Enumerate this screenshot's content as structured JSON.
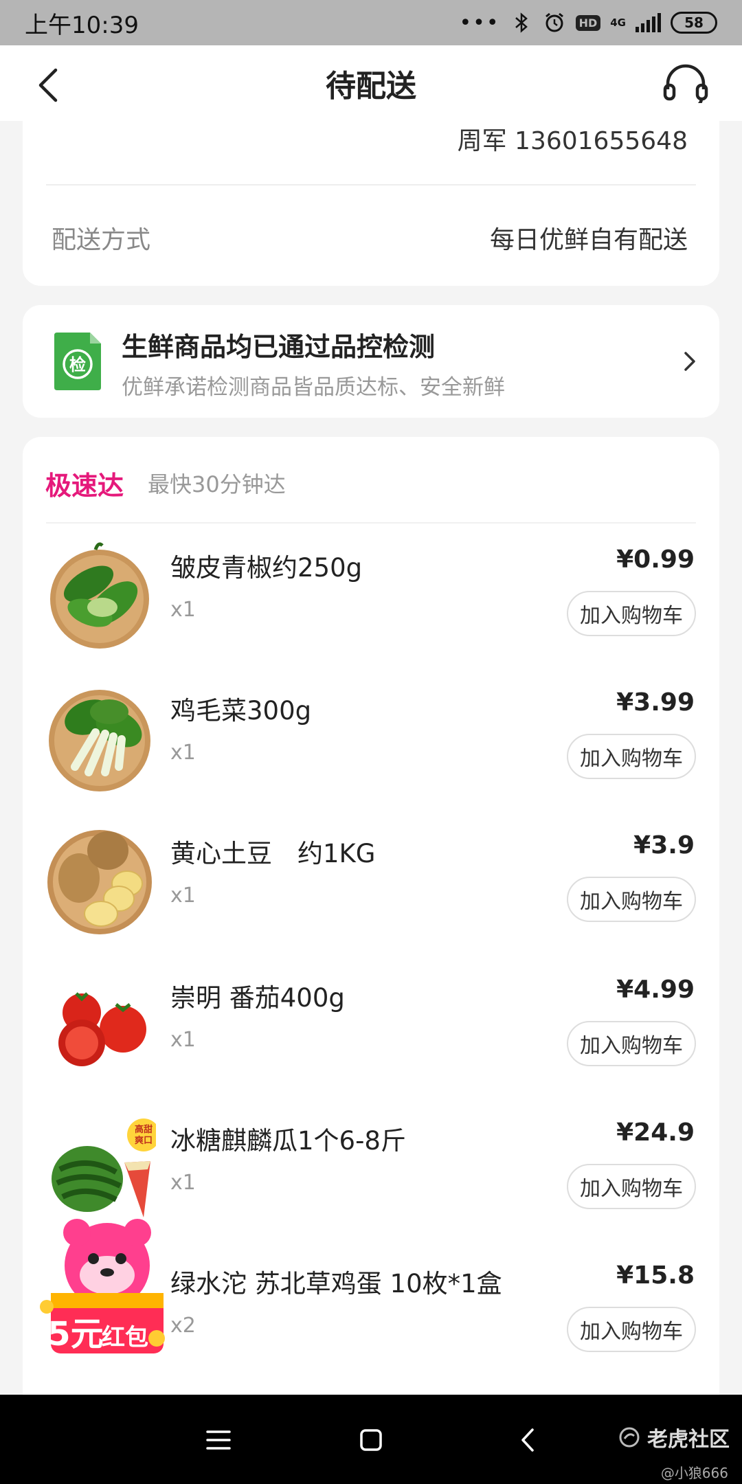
{
  "status_bar": {
    "time": "上午10:39",
    "network": "4G",
    "battery": "58"
  },
  "header": {
    "title": "待配送"
  },
  "address": {
    "contact": "周军 13601655648"
  },
  "delivery": {
    "label": "配送方式",
    "value": "每日优鲜自有配送"
  },
  "quality_check": {
    "badge": "检",
    "title": "生鲜商品均已通过品控检测",
    "subtitle": "优鲜承诺检测商品皆品质达标、安全新鲜"
  },
  "shipment": {
    "tag": "极速达",
    "note": "最快30分钟达"
  },
  "items": [
    {
      "name": "皱皮青椒约250g",
      "qty": "x1",
      "price": "¥0.99",
      "button": "加入购物车"
    },
    {
      "name": "鸡毛菜300g",
      "qty": "x1",
      "price": "¥3.99",
      "button": "加入购物车"
    },
    {
      "name": "黄心土豆　约1KG",
      "qty": "x1",
      "price": "¥3.9",
      "button": "加入购物车"
    },
    {
      "name": "崇明 番茄400g",
      "qty": "x1",
      "price": "¥4.99",
      "button": "加入购物车"
    },
    {
      "name": "冰糖麒麟瓜1个6-8斤",
      "qty": "x1",
      "price": "¥24.9",
      "button": "加入购物车",
      "tag": "高甜爽口"
    },
    {
      "name": "绿水沱 苏北草鸡蛋 10枚*1盒",
      "qty": "x2",
      "price": "¥15.8",
      "button": "加入购物车"
    }
  ],
  "promo": {
    "amount": "5元",
    "label": "红包"
  },
  "watermark": {
    "brand": "老虎社区",
    "user": "@小狼666"
  },
  "colors": {
    "accent": "#e5197b",
    "qc_green": "#3fae49"
  }
}
